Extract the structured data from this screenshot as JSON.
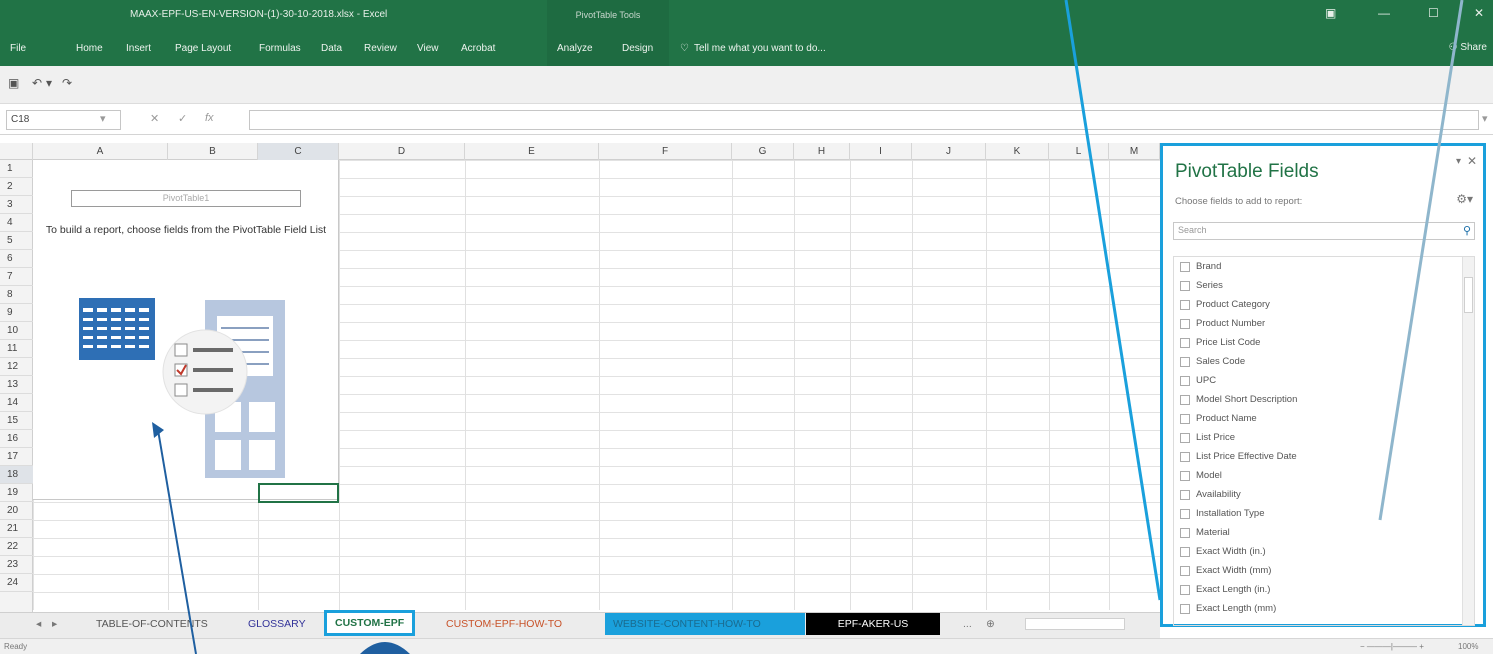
{
  "window": {
    "title": "MAAX-EPF-US-EN-VERSION-(1)-30-10-2018.xlsx - Excel",
    "context_tab": "PivotTable Tools",
    "share": "Share"
  },
  "ribbon": {
    "tabs": [
      "File",
      "Home",
      "Insert",
      "Page Layout",
      "Formulas",
      "Data",
      "Review",
      "View",
      "Acrobat",
      "Analyze",
      "Design"
    ],
    "tell_me": "Tell me what you want to do..."
  },
  "formula_bar": {
    "name_box": "C18",
    "fx": "fx",
    "value": ""
  },
  "columns": [
    "A",
    "B",
    "C",
    "D",
    "E",
    "F",
    "G",
    "H",
    "I",
    "J",
    "K",
    "L",
    "M"
  ],
  "rows": [
    "1",
    "2",
    "3",
    "4",
    "5",
    "6",
    "7",
    "8",
    "9",
    "10",
    "11",
    "12",
    "13",
    "14",
    "15",
    "16",
    "17",
    "18",
    "19",
    "20",
    "21",
    "22",
    "23",
    "24"
  ],
  "pivot_placeholder": {
    "name": "PivotTable1",
    "instruction": "To build a report, choose fields from the PivotTable Field List"
  },
  "sheet_tabs": [
    {
      "label": "TABLE-OF-CONTENTS",
      "color": "#ececec",
      "text": "#555555"
    },
    {
      "label": "GLOSSARY",
      "color": "#ececec",
      "text": "#333399"
    },
    {
      "label": "CUSTOM-EPF",
      "color": "#ffffff",
      "text": "#217346",
      "active": true
    },
    {
      "label": "CUSTOM-EPF-HOW-TO",
      "color": "#ececec",
      "text": "#c8532a"
    },
    {
      "label": "WEBSITE-CONTENT-HOW-TO",
      "color": "#1aa0dc",
      "text": "#1a6b8f"
    },
    {
      "label": "EPF-AKER-US",
      "color": "#000000",
      "text": "#ffffff"
    }
  ],
  "status": {
    "left": "Ready",
    "zoom": "100%"
  },
  "pivot_pane": {
    "title": "PivotTable Fields",
    "subtitle": "Choose fields to add to report:",
    "search_placeholder": "Search",
    "fields": [
      "Brand",
      "Series",
      "Product Category",
      "Product Number",
      "Price List Code",
      "Sales Code",
      "UPC",
      "Model Short Description",
      "Product Name",
      "List Price",
      "List Price Effective Date",
      "Model",
      "Availability",
      "Installation Type",
      "Material",
      "Exact Width (in.)",
      "Exact Width (mm)",
      "Exact Length (in.)",
      "Exact Length (mm)"
    ]
  },
  "accent_color": "#1aa0dc",
  "excel_green": "#217346"
}
